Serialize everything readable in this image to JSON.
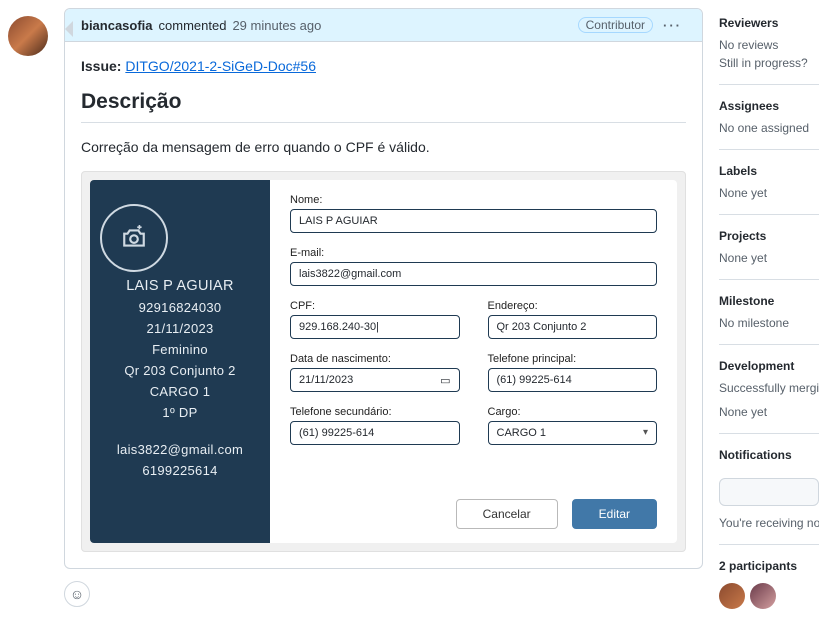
{
  "comment": {
    "username": "biancasofia",
    "action": "commented",
    "timestamp": "29 minutes ago",
    "badge": "Contributor"
  },
  "issue": {
    "label": "Issue:",
    "link_text": "DITGO/2021-2-SiGeD-Doc#56"
  },
  "section_heading": "Descrição",
  "description_text": "Correção da mensagem de erro quando o CPF é válido.",
  "form_card": {
    "side": {
      "name": "LAIS P AGUIAR",
      "cpf": "92916824030",
      "date": "21/11/2023",
      "gender": "Feminino",
      "address": "Qr 203 Conjunto 2",
      "cargo": "CARGO 1",
      "dp": "1º DP",
      "email": "lais3822@gmail.com",
      "phone": "6199225614"
    },
    "labels": {
      "nome": "Nome:",
      "email": "E-mail:",
      "cpf": "CPF:",
      "endereco": "Endereço:",
      "nascimento": "Data de nascimento:",
      "tel1": "Telefone principal:",
      "tel2": "Telefone secundário:",
      "cargo": "Cargo:"
    },
    "values": {
      "nome": "LAIS P AGUIAR",
      "email": "lais3822@gmail.com",
      "cpf": "929.168.240-30",
      "endereco": "Qr 203 Conjunto 2",
      "nascimento": "21/11/2023",
      "tel1": "(61) 99225-614",
      "tel2": "(61) 99225-614",
      "cargo": "CARGO 1"
    },
    "buttons": {
      "cancel": "Cancelar",
      "edit": "Editar"
    }
  },
  "sidebar": {
    "reviewers": {
      "title": "Reviewers",
      "text": "No reviews",
      "text2": "Still in progress?"
    },
    "assignees": {
      "title": "Assignees",
      "text": "No one assigned"
    },
    "labels": {
      "title": "Labels",
      "text": "None yet"
    },
    "projects": {
      "title": "Projects",
      "text": "None yet"
    },
    "milestone": {
      "title": "Milestone",
      "text": "No milestone"
    },
    "development": {
      "title": "Development",
      "text": "Successfully merging this pull request may close these issues.",
      "text2": "None yet"
    },
    "notifications": {
      "title": "Notifications",
      "text": "You're receiving notifications because you're watching this thread."
    },
    "participants": {
      "title": "2 participants"
    }
  }
}
